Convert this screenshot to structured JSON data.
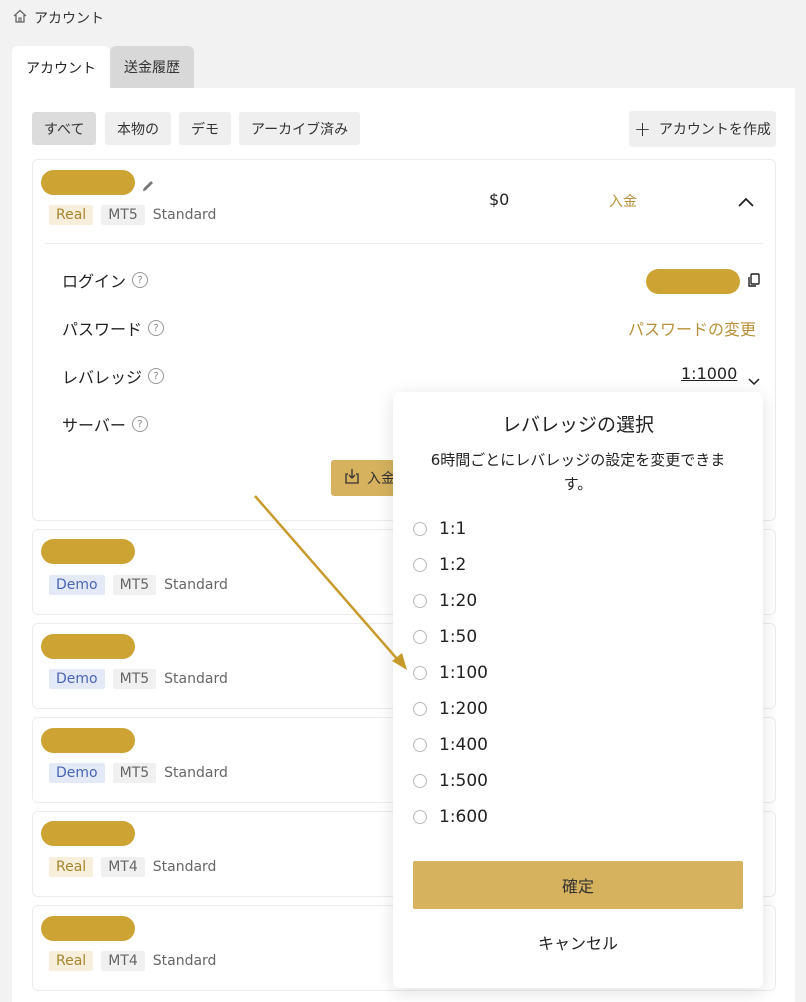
{
  "breadcrumb": {
    "icon": "home-icon",
    "label": "アカウント"
  },
  "tabs": [
    {
      "label": "アカウント",
      "active": true
    },
    {
      "label": "送金履歴",
      "active": false
    }
  ],
  "filters": [
    {
      "label": "すべて",
      "active": true
    },
    {
      "label": "本物の",
      "active": false
    },
    {
      "label": "デモ",
      "active": false
    },
    {
      "label": "アーカイブ済み",
      "active": false
    }
  ],
  "create_button": {
    "icon": "plus-icon",
    "label": "アカウントを作成"
  },
  "accounts": [
    {
      "type": "Real",
      "platform": "MT5",
      "plan": "Standard",
      "balance": "$0",
      "deposit_link": "入金",
      "expanded": true
    },
    {
      "type": "Demo",
      "platform": "MT5",
      "plan": "Standard"
    },
    {
      "type": "Demo",
      "platform": "MT5",
      "plan": "Standard"
    },
    {
      "type": "Demo",
      "platform": "MT5",
      "plan": "Standard"
    },
    {
      "type": "Real",
      "platform": "MT4",
      "plan": "Standard"
    },
    {
      "type": "Real",
      "platform": "MT4",
      "plan": "Standard"
    }
  ],
  "details": {
    "login_label": "ログイン",
    "password_label": "パスワード",
    "password_change": "パスワードの変更",
    "leverage_label": "レバレッジ",
    "leverage_value": "1:1000",
    "server_label": "サーバー",
    "deposit_button": "入金",
    "help_glyph": "?"
  },
  "leverage_modal": {
    "title": "レバレッジの選択",
    "description": "6時間ごとにレバレッジの設定を変更できます。",
    "options": [
      "1:1",
      "1:2",
      "1:20",
      "1:50",
      "1:100",
      "1:200",
      "1:400",
      "1:500",
      "1:600"
    ],
    "confirm": "確定",
    "cancel": "キャンセル"
  },
  "colors": {
    "accent_gold": "#cda434",
    "button_gold": "#d6b25e",
    "link_gold": "#b7903a",
    "real_tag_bg": "#f7eedb",
    "demo_tag_bg": "#e3e9f7",
    "annotation_arrow": "#c89a2c"
  }
}
